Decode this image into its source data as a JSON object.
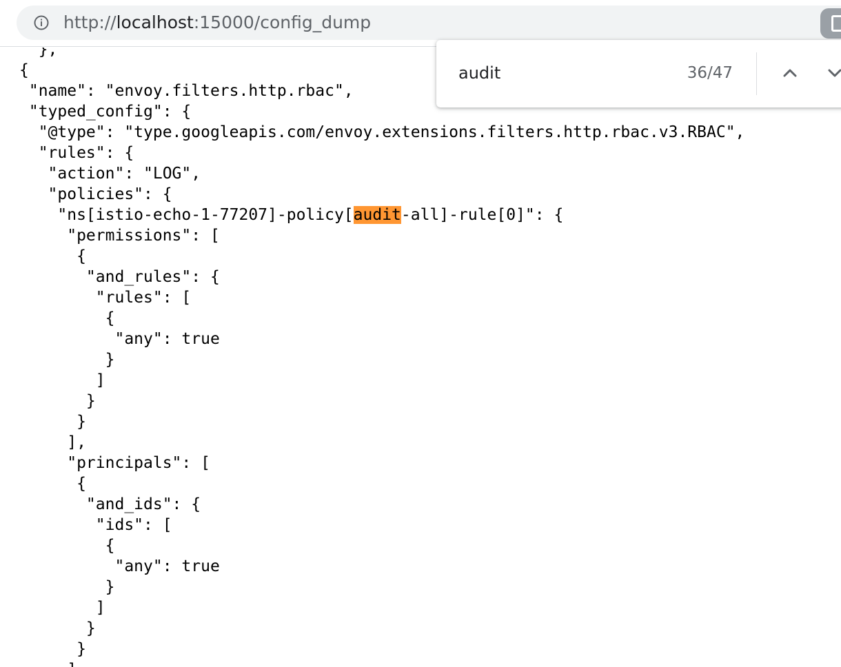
{
  "browser": {
    "url_scheme": "http://",
    "url_host": "localhost",
    "url_rest": ":15000/config_dump",
    "info_icon": "info-icon",
    "extension_icon": "extension-icon"
  },
  "find_bar": {
    "query": "audit",
    "match_count": "36/47",
    "prev_icon": "chevron-up-icon",
    "next_icon": "chevron-down-icon",
    "highlight_color": "#ff9632"
  },
  "json_lines": [
    "  },",
    "{",
    " \"name\": \"envoy.filters.http.rbac\",",
    " \"typed_config\": {",
    "  \"@type\": \"type.googleapis.com/envoy.extensions.filters.http.rbac.v3.RBAC\",",
    "  \"rules\": {",
    "   \"action\": \"LOG\",",
    "   \"policies\": {",
    "    \"ns[istio-echo-1-77207]-policy[audit-all]-rule[0]\": {",
    "     \"permissions\": [",
    "      {",
    "       \"and_rules\": {",
    "        \"rules\": [",
    "         {",
    "          \"any\": true",
    "         }",
    "        ]",
    "       }",
    "      }",
    "     ],",
    "     \"principals\": [",
    "      {",
    "       \"and_ids\": {",
    "        \"ids\": [",
    "         {",
    "          \"any\": true",
    "         }",
    "        ]",
    "       }",
    "      }",
    "     ]"
  ],
  "highlight_line_index": 8
}
